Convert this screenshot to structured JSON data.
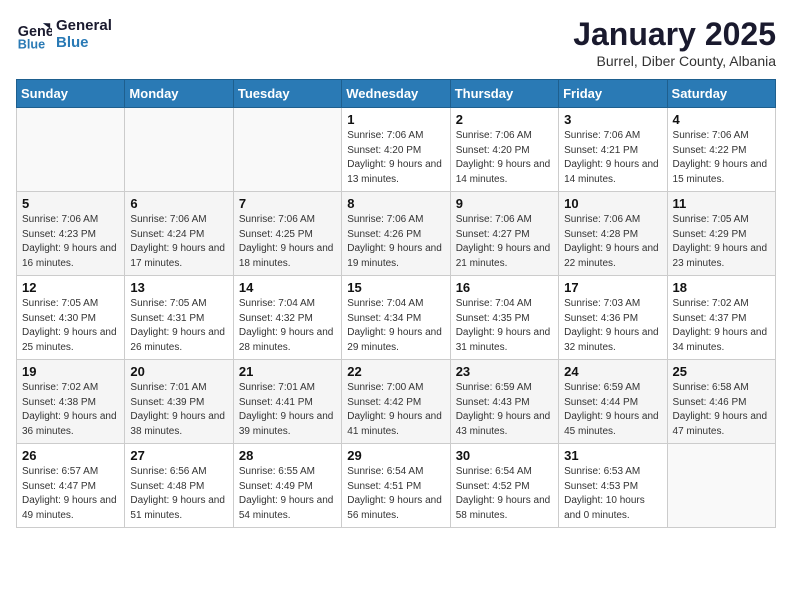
{
  "header": {
    "logo_line1": "General",
    "logo_line2": "Blue",
    "title": "January 2025",
    "subtitle": "Burrel, Diber County, Albania"
  },
  "days_of_week": [
    "Sunday",
    "Monday",
    "Tuesday",
    "Wednesday",
    "Thursday",
    "Friday",
    "Saturday"
  ],
  "weeks": [
    [
      {
        "day": "",
        "info": ""
      },
      {
        "day": "",
        "info": ""
      },
      {
        "day": "",
        "info": ""
      },
      {
        "day": "1",
        "info": "Sunrise: 7:06 AM\nSunset: 4:20 PM\nDaylight: 9 hours and 13 minutes."
      },
      {
        "day": "2",
        "info": "Sunrise: 7:06 AM\nSunset: 4:20 PM\nDaylight: 9 hours and 14 minutes."
      },
      {
        "day": "3",
        "info": "Sunrise: 7:06 AM\nSunset: 4:21 PM\nDaylight: 9 hours and 14 minutes."
      },
      {
        "day": "4",
        "info": "Sunrise: 7:06 AM\nSunset: 4:22 PM\nDaylight: 9 hours and 15 minutes."
      }
    ],
    [
      {
        "day": "5",
        "info": "Sunrise: 7:06 AM\nSunset: 4:23 PM\nDaylight: 9 hours and 16 minutes."
      },
      {
        "day": "6",
        "info": "Sunrise: 7:06 AM\nSunset: 4:24 PM\nDaylight: 9 hours and 17 minutes."
      },
      {
        "day": "7",
        "info": "Sunrise: 7:06 AM\nSunset: 4:25 PM\nDaylight: 9 hours and 18 minutes."
      },
      {
        "day": "8",
        "info": "Sunrise: 7:06 AM\nSunset: 4:26 PM\nDaylight: 9 hours and 19 minutes."
      },
      {
        "day": "9",
        "info": "Sunrise: 7:06 AM\nSunset: 4:27 PM\nDaylight: 9 hours and 21 minutes."
      },
      {
        "day": "10",
        "info": "Sunrise: 7:06 AM\nSunset: 4:28 PM\nDaylight: 9 hours and 22 minutes."
      },
      {
        "day": "11",
        "info": "Sunrise: 7:05 AM\nSunset: 4:29 PM\nDaylight: 9 hours and 23 minutes."
      }
    ],
    [
      {
        "day": "12",
        "info": "Sunrise: 7:05 AM\nSunset: 4:30 PM\nDaylight: 9 hours and 25 minutes."
      },
      {
        "day": "13",
        "info": "Sunrise: 7:05 AM\nSunset: 4:31 PM\nDaylight: 9 hours and 26 minutes."
      },
      {
        "day": "14",
        "info": "Sunrise: 7:04 AM\nSunset: 4:32 PM\nDaylight: 9 hours and 28 minutes."
      },
      {
        "day": "15",
        "info": "Sunrise: 7:04 AM\nSunset: 4:34 PM\nDaylight: 9 hours and 29 minutes."
      },
      {
        "day": "16",
        "info": "Sunrise: 7:04 AM\nSunset: 4:35 PM\nDaylight: 9 hours and 31 minutes."
      },
      {
        "day": "17",
        "info": "Sunrise: 7:03 AM\nSunset: 4:36 PM\nDaylight: 9 hours and 32 minutes."
      },
      {
        "day": "18",
        "info": "Sunrise: 7:02 AM\nSunset: 4:37 PM\nDaylight: 9 hours and 34 minutes."
      }
    ],
    [
      {
        "day": "19",
        "info": "Sunrise: 7:02 AM\nSunset: 4:38 PM\nDaylight: 9 hours and 36 minutes."
      },
      {
        "day": "20",
        "info": "Sunrise: 7:01 AM\nSunset: 4:39 PM\nDaylight: 9 hours and 38 minutes."
      },
      {
        "day": "21",
        "info": "Sunrise: 7:01 AM\nSunset: 4:41 PM\nDaylight: 9 hours and 39 minutes."
      },
      {
        "day": "22",
        "info": "Sunrise: 7:00 AM\nSunset: 4:42 PM\nDaylight: 9 hours and 41 minutes."
      },
      {
        "day": "23",
        "info": "Sunrise: 6:59 AM\nSunset: 4:43 PM\nDaylight: 9 hours and 43 minutes."
      },
      {
        "day": "24",
        "info": "Sunrise: 6:59 AM\nSunset: 4:44 PM\nDaylight: 9 hours and 45 minutes."
      },
      {
        "day": "25",
        "info": "Sunrise: 6:58 AM\nSunset: 4:46 PM\nDaylight: 9 hours and 47 minutes."
      }
    ],
    [
      {
        "day": "26",
        "info": "Sunrise: 6:57 AM\nSunset: 4:47 PM\nDaylight: 9 hours and 49 minutes."
      },
      {
        "day": "27",
        "info": "Sunrise: 6:56 AM\nSunset: 4:48 PM\nDaylight: 9 hours and 51 minutes."
      },
      {
        "day": "28",
        "info": "Sunrise: 6:55 AM\nSunset: 4:49 PM\nDaylight: 9 hours and 54 minutes."
      },
      {
        "day": "29",
        "info": "Sunrise: 6:54 AM\nSunset: 4:51 PM\nDaylight: 9 hours and 56 minutes."
      },
      {
        "day": "30",
        "info": "Sunrise: 6:54 AM\nSunset: 4:52 PM\nDaylight: 9 hours and 58 minutes."
      },
      {
        "day": "31",
        "info": "Sunrise: 6:53 AM\nSunset: 4:53 PM\nDaylight: 10 hours and 0 minutes."
      },
      {
        "day": "",
        "info": ""
      }
    ]
  ]
}
